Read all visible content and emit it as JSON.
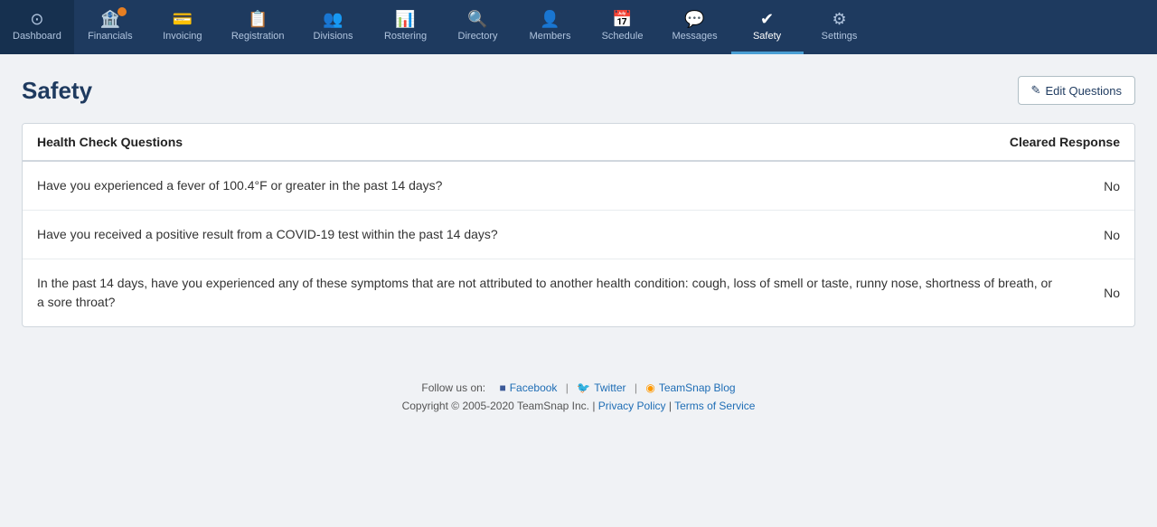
{
  "nav": {
    "items": [
      {
        "id": "dashboard",
        "label": "Dashboard",
        "icon": "⊙",
        "active": false,
        "badge": false
      },
      {
        "id": "financials",
        "label": "Financials",
        "icon": "🏦",
        "active": false,
        "badge": true
      },
      {
        "id": "invoicing",
        "label": "Invoicing",
        "icon": "💳",
        "active": false,
        "badge": false
      },
      {
        "id": "registration",
        "label": "Registration",
        "icon": "📋",
        "active": false,
        "badge": false
      },
      {
        "id": "divisions",
        "label": "Divisions",
        "icon": "👥",
        "active": false,
        "badge": false
      },
      {
        "id": "rostering",
        "label": "Rostering",
        "icon": "📊",
        "active": false,
        "badge": false
      },
      {
        "id": "directory",
        "label": "Directory",
        "icon": "🔍",
        "active": false,
        "badge": false
      },
      {
        "id": "members",
        "label": "Members",
        "icon": "👤",
        "active": false,
        "badge": false
      },
      {
        "id": "schedule",
        "label": "Schedule",
        "icon": "📅",
        "active": false,
        "badge": false
      },
      {
        "id": "messages",
        "label": "Messages",
        "icon": "💬",
        "active": false,
        "badge": false
      },
      {
        "id": "safety",
        "label": "Safety",
        "icon": "✔",
        "active": true,
        "badge": false
      },
      {
        "id": "settings",
        "label": "Settings",
        "icon": "⚙",
        "active": false,
        "badge": false
      }
    ]
  },
  "page": {
    "title": "Safety",
    "edit_button_label": "Edit Questions"
  },
  "table": {
    "col_question": "Health Check Questions",
    "col_response": "Cleared Response",
    "rows": [
      {
        "question": "Have you experienced a fever of 100.4°F or greater in the past 14 days?",
        "response": "No"
      },
      {
        "question": "Have you received a positive result from a COVID-19 test within the past 14 days?",
        "response": "No"
      },
      {
        "question": "In the past 14 days, have you experienced any of these symptoms that are not attributed to another health condition: cough, loss of smell or taste, runny nose, shortness of breath, or a sore throat?",
        "response": "No"
      }
    ]
  },
  "footer": {
    "follow_text": "Follow us on:",
    "facebook_label": "Facebook",
    "twitter_label": "Twitter",
    "blog_label": "TeamSnap Blog",
    "copyright": "Copyright © 2005-2020 TeamSnap Inc.",
    "privacy_label": "Privacy Policy",
    "terms_label": "Terms of Service"
  }
}
